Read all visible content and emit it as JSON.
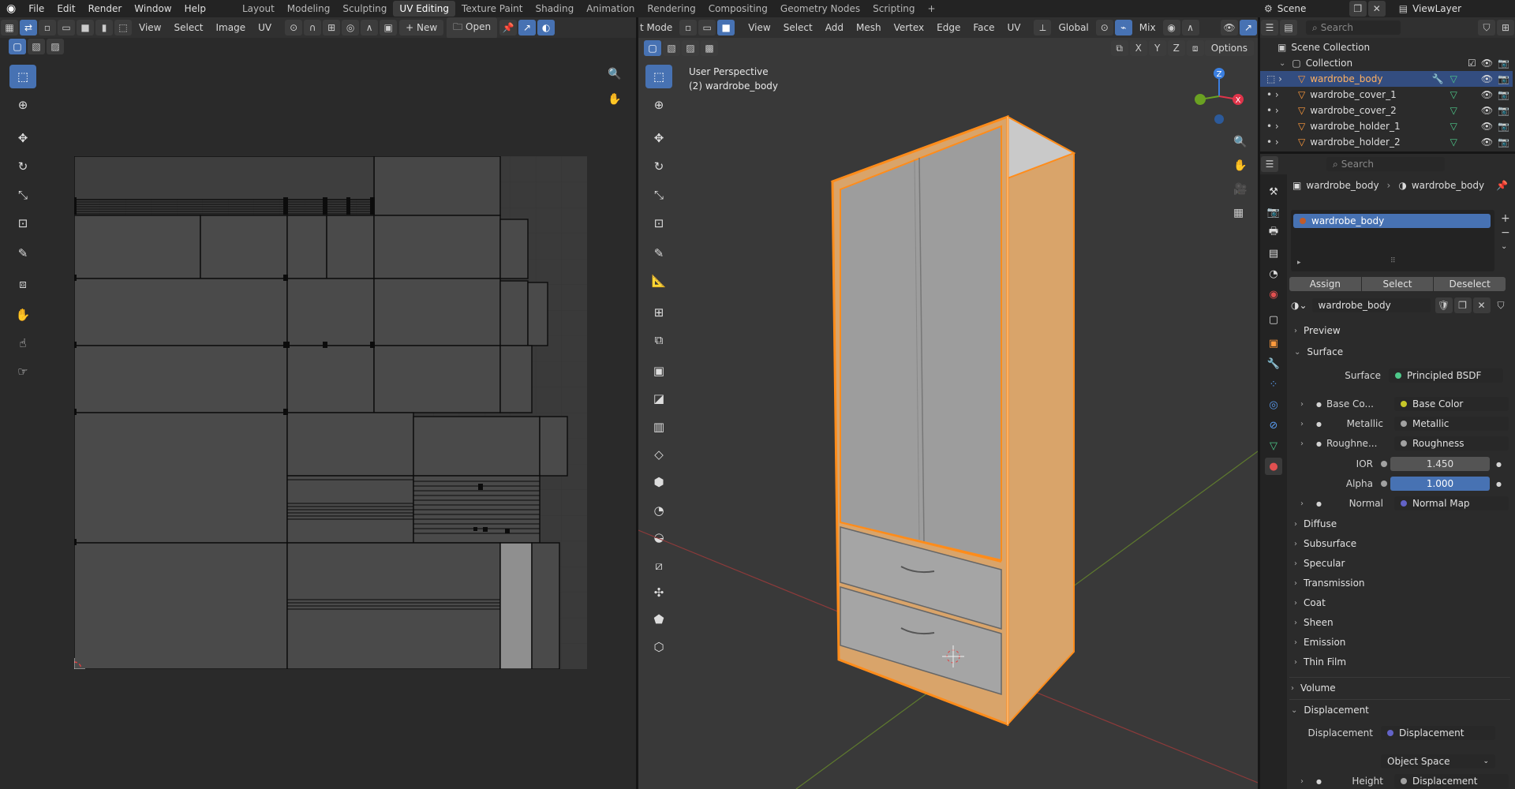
{
  "topbar": {
    "menus": [
      "File",
      "Edit",
      "Render",
      "Window",
      "Help"
    ],
    "workspaces": [
      "Layout",
      "Modeling",
      "Sculpting",
      "UV Editing",
      "Texture Paint",
      "Shading",
      "Animation",
      "Rendering",
      "Compositing",
      "Geometry Nodes",
      "Scripting"
    ],
    "active_workspace": "UV Editing",
    "scene": "Scene",
    "view_layer": "ViewLayer"
  },
  "uv_editor": {
    "menus": [
      "View",
      "Select",
      "Image",
      "UV"
    ],
    "new_label": "New",
    "open_label": "Open"
  },
  "viewport": {
    "mode_label": "t Mode",
    "menus": [
      "View",
      "Select",
      "Add",
      "Mesh",
      "Vertex",
      "Edge",
      "Face",
      "UV"
    ],
    "orientation": "Global",
    "pivot": "Mix",
    "options_label": "Options",
    "axes": [
      "X",
      "Y",
      "Z"
    ],
    "info_line1": "User Perspective",
    "info_line2": "(2) wardrobe_body"
  },
  "outliner": {
    "search_placeholder": "Search",
    "root": "Scene Collection",
    "collection": "Collection",
    "objects": [
      "wardrobe_body",
      "wardrobe_cover_1",
      "wardrobe_cover_2",
      "wardrobe_holder_1",
      "wardrobe_holder_2"
    ],
    "selected": "wardrobe_body"
  },
  "properties": {
    "search_placeholder": "Search",
    "breadcrumb_object": "wardrobe_body",
    "breadcrumb_material": "wardrobe_body",
    "slot_name": "wardrobe_body",
    "assign": "Assign",
    "select": "Select",
    "deselect": "Deselect",
    "material_name": "wardrobe_body",
    "preview": "Preview",
    "surface_section": "Surface",
    "surface_label": "Surface",
    "surface_value": "Principled BSDF",
    "inputs": [
      {
        "label": "Base Co...",
        "value": "Base Color",
        "color": "#c7c729"
      },
      {
        "label": "Metallic",
        "value": "Metallic",
        "color": "#a1a1a1"
      },
      {
        "label": "Roughne...",
        "value": "Roughness",
        "color": "#a1a1a1"
      }
    ],
    "ior_label": "IOR",
    "ior_value": "1.450",
    "alpha_label": "Alpha",
    "alpha_value": "1.000",
    "normal_label": "Normal",
    "normal_value": "Normal Map",
    "subsections": [
      "Diffuse",
      "Subsurface",
      "Specular",
      "Transmission",
      "Coat",
      "Sheen",
      "Emission",
      "Thin Film"
    ],
    "volume": "Volume",
    "displacement_section": "Displacement",
    "displacement_label": "Displacement",
    "displacement_value": "Displacement",
    "space_value": "Object Space",
    "height_label": "Height",
    "height_value": "Displacement"
  },
  "colors": {
    "accent": "#4772b3",
    "selection_orange": "#ff8c1a",
    "axis_red": "#e0344a",
    "axis_green": "#6aa122",
    "axis_blue": "#3b7fe0"
  }
}
